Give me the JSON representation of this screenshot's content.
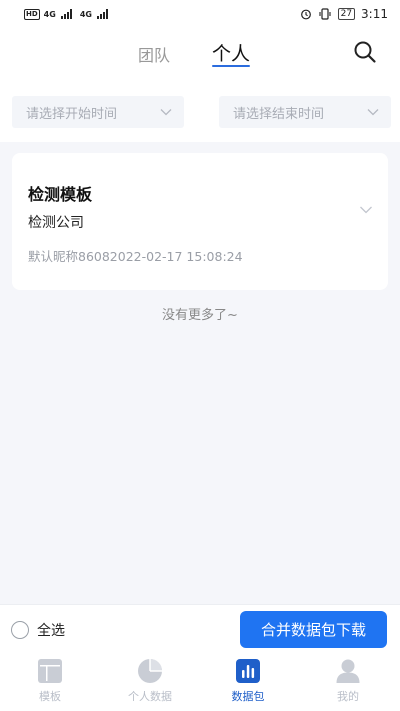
{
  "status_bar": {
    "hd": "HD",
    "net1": "4G",
    "net2": "4G",
    "battery": "27",
    "time": "3:11"
  },
  "header": {
    "tabs": [
      {
        "label": "团队",
        "active": false
      },
      {
        "label": "个人",
        "active": true
      }
    ]
  },
  "filters": {
    "start_placeholder": "请选择开始时间",
    "end_placeholder": "请选择结束时间"
  },
  "items": [
    {
      "title": "检测模板",
      "company": "检测公司",
      "meta": "默认昵称86082022-02-17 15:08:24"
    }
  ],
  "list_end_text": "没有更多了~",
  "action_bar": {
    "select_all_label": "全选",
    "merge_button_label": "合并数据包下载"
  },
  "tab_bar": {
    "items": [
      {
        "label": "模板",
        "icon": "template-icon",
        "active": false
      },
      {
        "label": "个人数据",
        "icon": "pie-chart-icon",
        "active": false
      },
      {
        "label": "数据包",
        "icon": "bar-chart-icon",
        "active": true
      },
      {
        "label": "我的",
        "icon": "profile-icon",
        "active": false
      }
    ]
  },
  "colors": {
    "accent": "#1f74f2",
    "active_tab": "#1f5fc9",
    "inactive_tab": "#b9bec8",
    "background": "#f5f6fa"
  }
}
